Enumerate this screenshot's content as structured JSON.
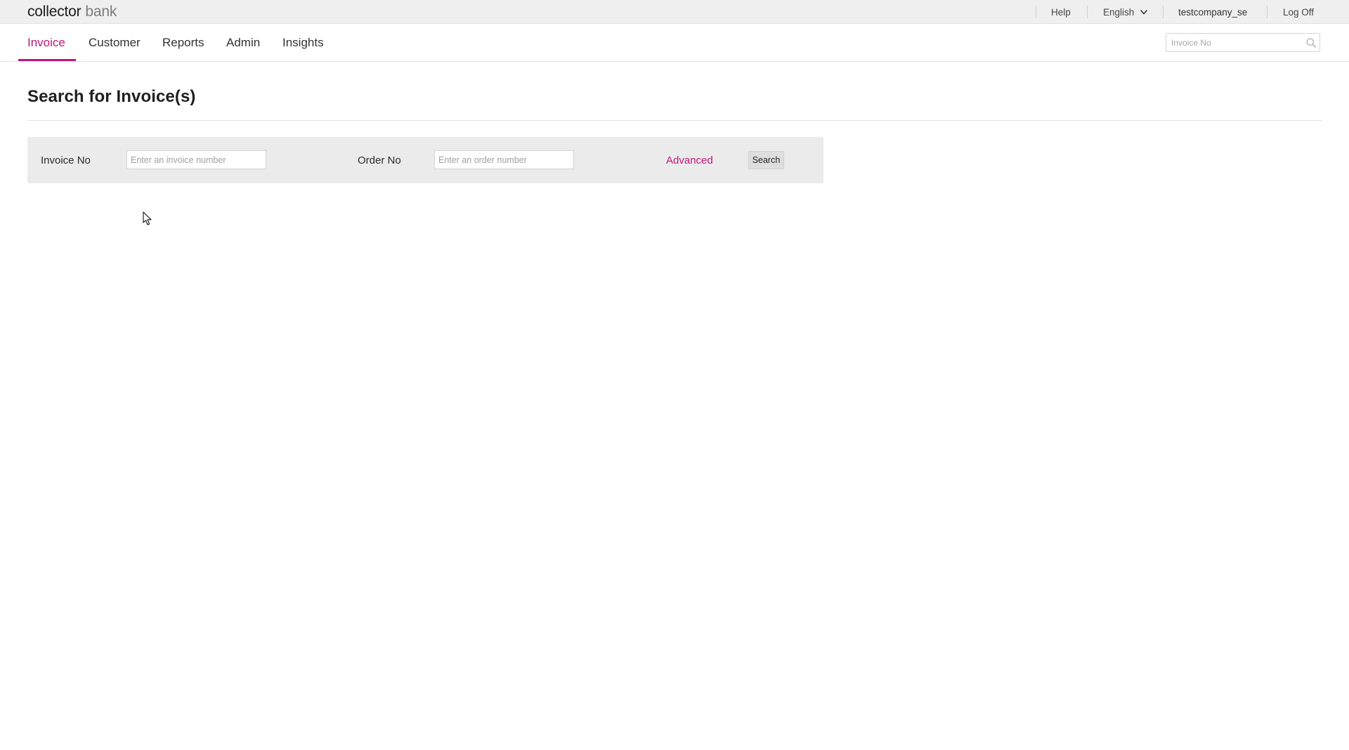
{
  "brand": {
    "name_part1": "collector",
    "name_part2": "bank"
  },
  "utility_bar": {
    "help": "Help",
    "language": "English",
    "username": "testcompany_se",
    "log_off": "Log Off"
  },
  "nav": {
    "items": [
      {
        "label": "Invoice",
        "active": true
      },
      {
        "label": "Customer",
        "active": false
      },
      {
        "label": "Reports",
        "active": false
      },
      {
        "label": "Admin",
        "active": false
      },
      {
        "label": "Insights",
        "active": false
      }
    ],
    "quick_search_placeholder": "Invoice No"
  },
  "page": {
    "title": "Search for Invoice(s)"
  },
  "search_form": {
    "invoice_label": "Invoice No",
    "invoice_placeholder": "Enter an invoice number",
    "order_label": "Order No",
    "order_placeholder": "Enter an order number",
    "advanced_link": "Advanced",
    "search_button": "Search"
  },
  "colors": {
    "accent": "#c0177a",
    "topbar_bg": "#efefef",
    "panel_bg": "#ebebeb"
  },
  "icons": {
    "language_dropdown": "chevron-down-icon",
    "quick_search": "search-icon",
    "cursor": "mouse-pointer-icon"
  }
}
